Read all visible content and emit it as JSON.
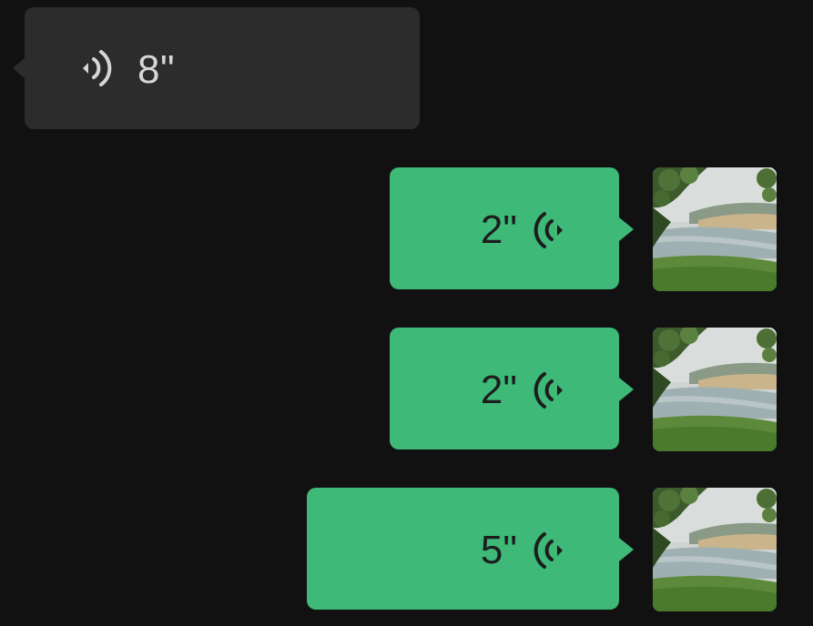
{
  "messages": {
    "incoming": [
      {
        "duration": "8\"",
        "icon": "voice-wave-icon"
      }
    ],
    "outgoing": [
      {
        "duration": "2\"",
        "icon": "voice-wave-icon",
        "avatar": "river-landscape-avatar"
      },
      {
        "duration": "2\"",
        "icon": "voice-wave-icon",
        "avatar": "river-landscape-avatar"
      },
      {
        "duration": "5\"",
        "icon": "voice-wave-icon",
        "avatar": "river-landscape-avatar"
      }
    ]
  },
  "colors": {
    "background": "#111111",
    "incoming_bubble": "#2c2c2c",
    "outgoing_bubble": "#3fb977",
    "incoming_text": "#d6d6d6",
    "outgoing_text": "#1d1d1d"
  }
}
